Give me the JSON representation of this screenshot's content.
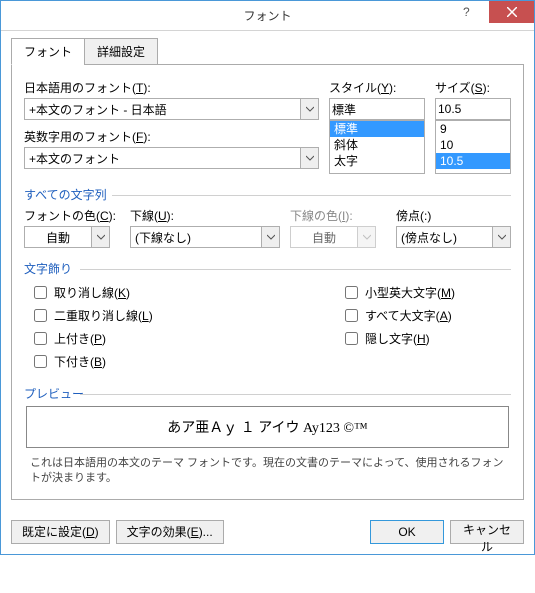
{
  "title": "フォント",
  "tabs": {
    "font": "フォント",
    "advanced": "詳細設定"
  },
  "labels": {
    "jpFont": "日本語用のフォント(T):",
    "latinFont": "英数字用のフォント(F):",
    "style": "スタイル(Y):",
    "size": "サイズ(S):",
    "allText": "すべての文字列",
    "fontColor": "フォントの色(C):",
    "underline": "下線(U):",
    "underlineColor": "下線の色(I):",
    "emphasis": "傍点(:)",
    "effects": "文字飾り",
    "preview": "プレビュー"
  },
  "values": {
    "jpFont": "+本文のフォント - 日本語",
    "latinFont": "+本文のフォント",
    "style": "標準",
    "size": "10.5",
    "fontColor": "自動",
    "underline": "(下線なし)",
    "underlineColor": "自動",
    "emphasis": "(傍点なし)"
  },
  "styleOptions": [
    "標準",
    "斜体",
    "太字"
  ],
  "sizeOptions": [
    "9",
    "10",
    "10.5"
  ],
  "effects": {
    "strike": "取り消し線(K)",
    "dblstrike": "二重取り消し線(L)",
    "superscript": "上付き(P)",
    "subscript": "下付き(B)",
    "smallcaps": "小型英大文字(M)",
    "allcaps": "すべて大文字(A)",
    "hidden": "隠し文字(H)"
  },
  "previewText": "あア亜Ａｙ １ アイウ Ay123 ©™",
  "desc": "これは日本語用の本文のテーマ フォントです。現在の文書のテーマによって、使用されるフォントが決まります。",
  "buttons": {
    "setDefault": "既定に設定(D)",
    "textEffects": "文字の効果(E)...",
    "ok": "OK",
    "cancel": "キャンセル"
  }
}
